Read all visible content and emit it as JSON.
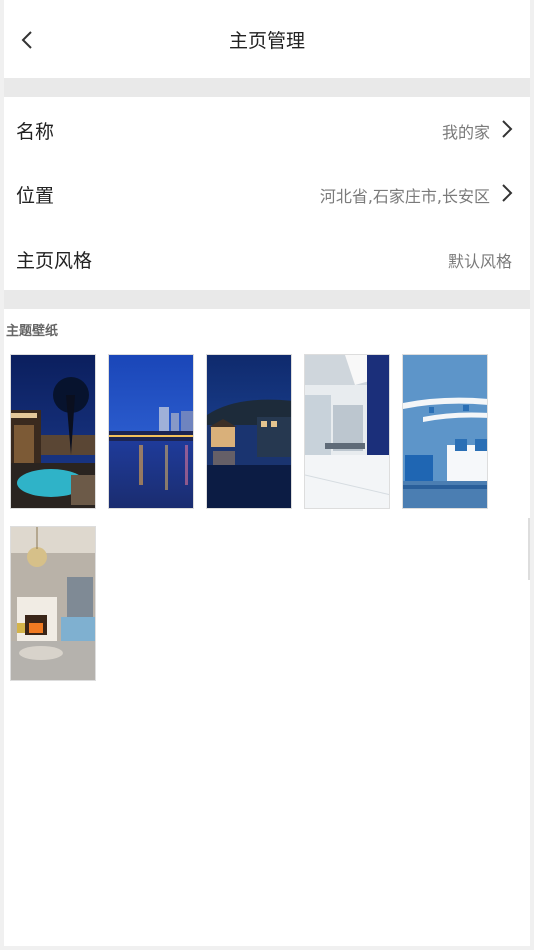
{
  "nav": {
    "title": "主页管理",
    "back_icon": "chevron-left-icon"
  },
  "settings": {
    "name": {
      "label": "名称",
      "value": "我的家"
    },
    "location": {
      "label": "位置",
      "value": "河北省,石家庄市,长安区"
    },
    "style": {
      "label": "主页风格",
      "value": "默认风格"
    }
  },
  "wallpapers": {
    "title": "主题壁纸",
    "items": [
      "pool-villa-night",
      "harbor-city-night",
      "waterfront-pavilion-night",
      "white-office-blue-wall",
      "blue-white-living-room",
      "classic-living-room-fireplace"
    ]
  },
  "colors": {
    "divider": "#e9e9e9",
    "text": "#222222",
    "muted": "#7a7a7a"
  }
}
